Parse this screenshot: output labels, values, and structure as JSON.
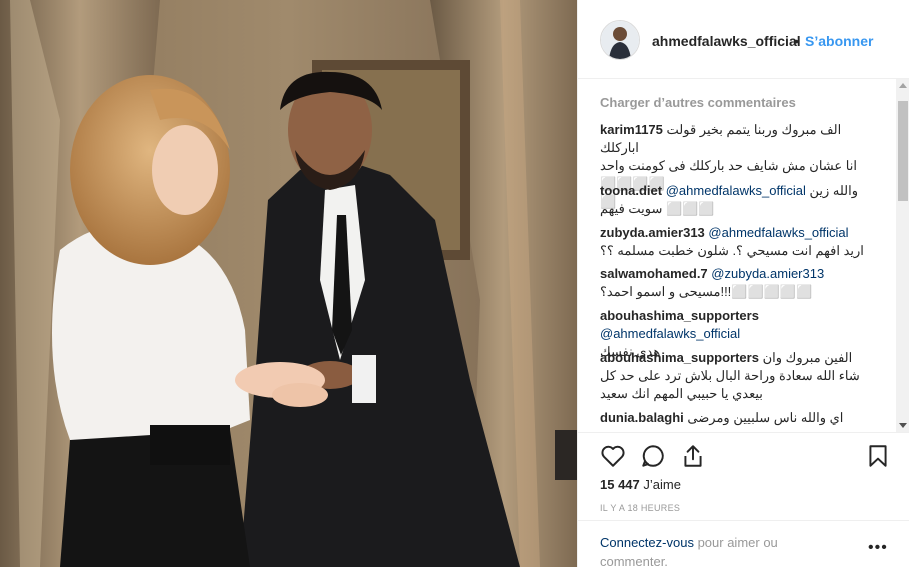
{
  "post": {
    "username": "ahmedfalawks_official",
    "separator": "•",
    "follow_label": "S’abonner"
  },
  "comments_panel": {
    "load_more": "Charger d’autres commentaires",
    "items": [
      {
        "user": "karim1175",
        "mention": "",
        "text": "الف مبروك وربنا يتمم بخير قولت اباركلك\nانا عشان مش شايف حد باركلك فى كومنت واحد ⬜⬜⬜⬜\n⬜"
      },
      {
        "user": "toona.diet",
        "mention": "@ahmedfalawks_official",
        "text": "والله زين\nسويت فيهم ⬜⬜⬜"
      },
      {
        "user": "zubyda.amier313",
        "mention": "@ahmedfalawks_official",
        "text": "\nاريد افهم انت مسيحي ؟. شلون خطبت مسلمه ؟؟"
      },
      {
        "user": "salwamohamed.7",
        "mention": "@zubyda.amier313",
        "text": "\nمسيحى و اسمو احمد؟!!!⬜⬜⬜⬜⬜"
      },
      {
        "user": "abouhashima_supporters",
        "mention": "@ahmedfalawks_official",
        "text": "\nهدي نفسك"
      },
      {
        "user": "abouhashima_supporters",
        "mention": "",
        "text": "الفين مبروك وان شاء الله سعادة وراحة البال بلاش ترد على حد كل بيعدي يا حبيبي المهم انك سعيد"
      },
      {
        "user": "dunia.balaghi",
        "mention": "",
        "text": "اي والله ناس سلبيين ومرضى نفسيين"
      }
    ]
  },
  "actions": {
    "like_icon": "heart-icon",
    "comment_icon": "comment-icon",
    "share_icon": "share-icon",
    "save_icon": "bookmark-icon"
  },
  "likes": {
    "count": "15 447",
    "label": "J’aime"
  },
  "timestamp": "IL Y A 18 HEURES",
  "login_prompt": {
    "link": "Connectez-vous",
    "text": " pour aimer ou commenter."
  },
  "more_label": "•••",
  "colors": {
    "link_blue": "#3897f0",
    "mention_blue": "#003569",
    "muted": "#999999"
  }
}
